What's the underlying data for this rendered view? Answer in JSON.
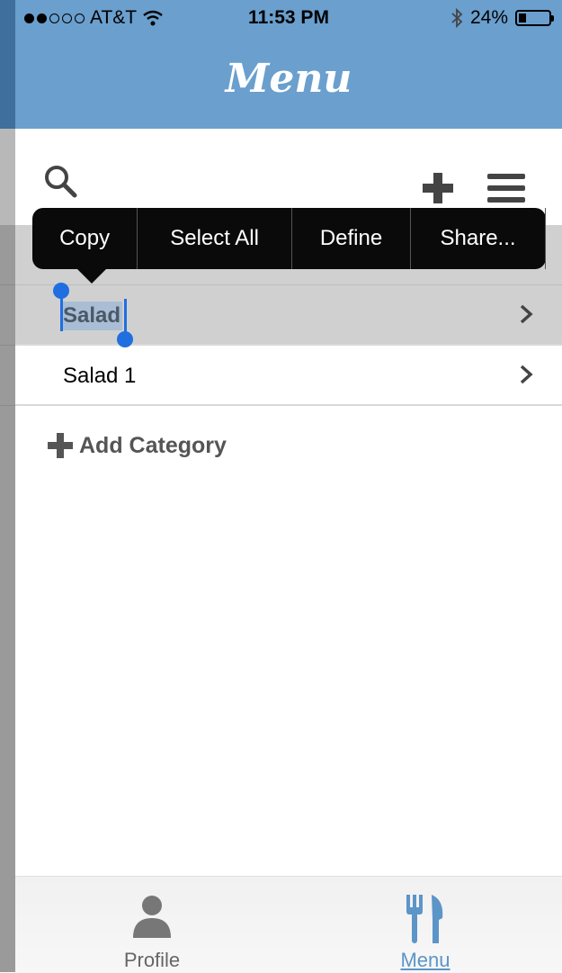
{
  "status": {
    "carrier": "AT&T",
    "time": "11:53 PM",
    "battery": "24%",
    "battery_level": 0.24
  },
  "header": {
    "title": "Menu"
  },
  "toolbar": {
    "search_icon": "search-icon",
    "add_icon": "plus-icon",
    "menu_icon": "hamburger-icon"
  },
  "popup": {
    "items": [
      "Copy",
      "Select All",
      "Define",
      "Share..."
    ]
  },
  "list": {
    "items": [
      {
        "label": "Salad",
        "selected": true
      },
      {
        "label": "Salad 1",
        "selected": false
      }
    ]
  },
  "add_category": {
    "label": "Add Category"
  },
  "tabs": {
    "items": [
      {
        "label": "Profile",
        "icon": "person-icon"
      },
      {
        "label": "Menu",
        "icon": "fork-knife-icon",
        "active": true
      }
    ]
  },
  "colors": {
    "header": "#6a9fce",
    "selection": "#1f6fe0",
    "active_tab": "#5c95c8"
  }
}
